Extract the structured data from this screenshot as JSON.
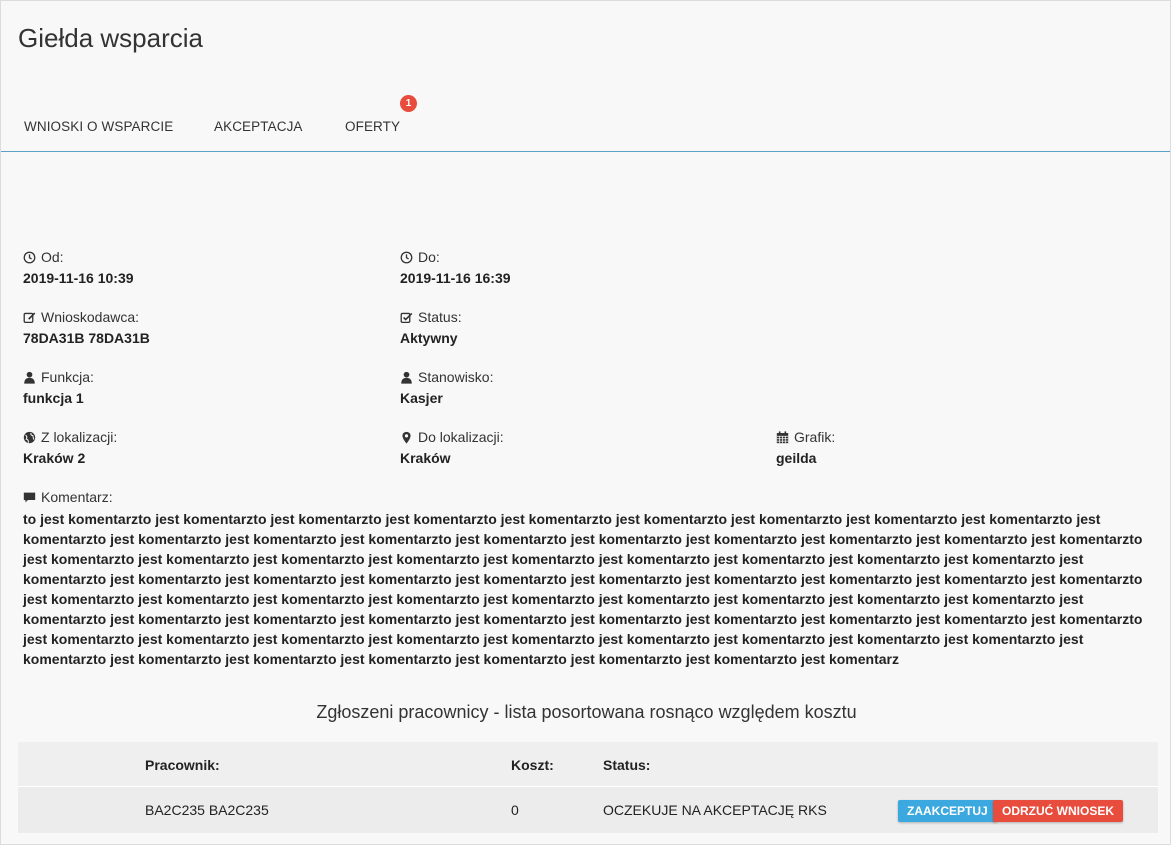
{
  "header": {
    "title": "Giełda wsparcia"
  },
  "tabs": [
    {
      "label": "WNIOSKI O WSPARCIE"
    },
    {
      "label": "AKCEPTACJA"
    },
    {
      "label": "OFERTY",
      "badge": "1"
    }
  ],
  "details": {
    "od": {
      "label": "Od:",
      "value": "2019-11-16 10:39",
      "icon": "clock-icon"
    },
    "do": {
      "label": "Do:",
      "value": "2019-11-16 16:39",
      "icon": "clock-icon"
    },
    "wnioskodawca": {
      "label": "Wnioskodawca:",
      "value": "78DA31B 78DA31B",
      "icon": "edit-icon"
    },
    "status": {
      "label": "Status:",
      "value": "Aktywny",
      "icon": "check-square-icon"
    },
    "funkcja": {
      "label": "Funkcja:",
      "value": "funkcja 1",
      "icon": "user-icon"
    },
    "stanowisko": {
      "label": "Stanowisko:",
      "value": "Kasjer",
      "icon": "user-icon"
    },
    "z_lokalizacji": {
      "label": "Z lokalizacji:",
      "value": "Kraków 2",
      "icon": "globe-icon"
    },
    "do_lokalizacji": {
      "label": "Do lokalizacji:",
      "value": "Kraków",
      "icon": "map-marker-icon"
    },
    "grafik": {
      "label": "Grafik:",
      "value": "geilda",
      "icon": "calendar-icon"
    },
    "komentarz": {
      "label": "Komentarz:",
      "icon": "comment-icon",
      "value": "to jest komentarzto jest komentarzto jest komentarzto jest komentarzto jest komentarzto jest komentarzto jest komentarzto jest komentarzto jest komentarzto jest komentarzto jest komentarzto jest komentarzto jest komentarzto jest komentarzto jest komentarzto jest komentarzto jest komentarzto jest komentarzto jest komentarzto jest komentarzto jest komentarzto jest komentarzto jest komentarzto jest komentarzto jest komentarzto jest komentarzto jest komentarzto jest komentarzto jest komentarzto jest komentarzto jest komentarzto jest komentarzto jest komentarzto jest komentarzto jest komentarzto jest komentarzto jest komentarzto jest komentarzto jest komentarzto jest komentarzto jest komentarzto jest komentarzto jest komentarzto jest komentarzto jest komentarzto jest komentarzto jest komentarzto jest komentarzto jest komentarzto jest komentarzto jest komentarzto jest komentarzto jest komentarzto jest komentarzto jest komentarzto jest komentarzto jest komentarzto jest komentarzto jest komentarzto jest komentarzto jest komentarzto jest komentarzto jest komentarzto jest komentarzto jest komentarzto jest komentarzto jest komentarzto jest komentarzto jest komentarzto jest komentarzto jest komentarzto jest komentarzto jest komentarzto jest komentarz"
    }
  },
  "list": {
    "title": "Zgłoszeni pracownicy - lista posortowana rosnąco względem kosztu",
    "headers": {
      "pracownik": "Pracownik:",
      "koszt": "Koszt:",
      "status": "Status:"
    },
    "rows": [
      {
        "pracownik": "BA2C235 BA2C235",
        "koszt": "0",
        "status": "OCZEKUJE NA AKCEPTACJĘ RKS",
        "accept_label": "ZAAKCEPTUJ",
        "reject_label": "ODRZUĆ WNIOSEK"
      }
    ]
  },
  "colors": {
    "accent": "#5aa0c8",
    "badge": "#e84c3d",
    "accept": "#3ba9e0",
    "reject": "#e84c3d"
  }
}
